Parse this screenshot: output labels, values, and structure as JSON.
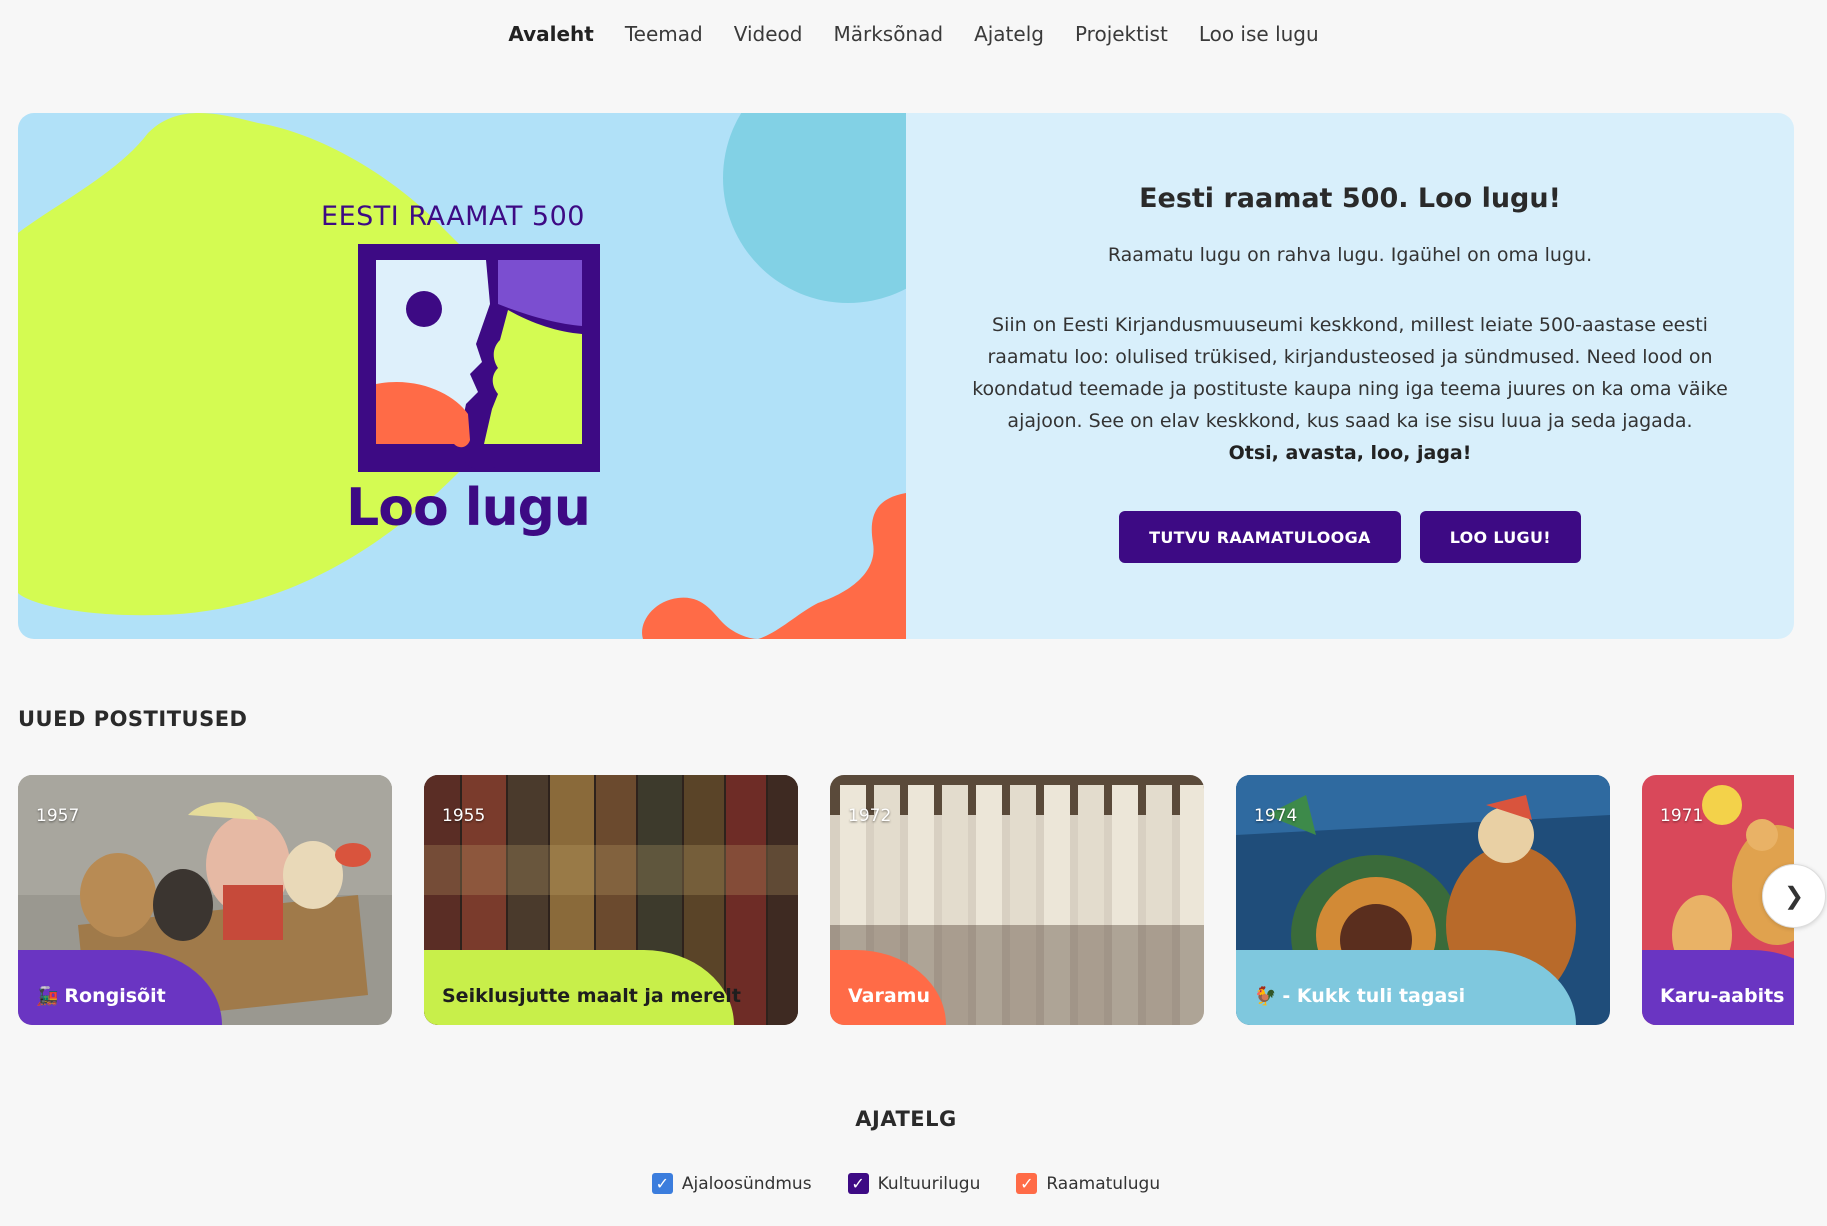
{
  "nav": {
    "items": [
      {
        "label": "Avaleht",
        "active": true
      },
      {
        "label": "Teemad"
      },
      {
        "label": "Videod"
      },
      {
        "label": "Märksõnad"
      },
      {
        "label": "Ajatelg"
      },
      {
        "label": "Projektist"
      },
      {
        "label": "Loo ise lugu"
      }
    ]
  },
  "hero": {
    "logo_top": "EESTI RAAMAT 500",
    "logo_bottom": "Loo lugu",
    "title": "Eesti raamat 500. Loo lugu!",
    "tagline": "Raamatu lugu on rahva lugu. Igaühel on oma lugu.",
    "body": "Siin on Eesti Kirjandusmuuseumi keskkond, millest leiate 500-aastase eesti raamatu loo: olulised trükised, kirjandusteosed ja sündmused. Need lood on koondatud teemade ja postituste kaupa ning iga teema juures on ka oma väike ajajoon. See on elav keskkond, kus saad ka ise sisu luua ja seda jagada.",
    "strong": "Otsi, avasta, loo, jaga!",
    "btn_primary": "TUTVU RAAMATULOOGA",
    "btn_secondary": "LOO LUGU!",
    "colors": {
      "lime": "#d4fb52",
      "sky": "#b1e1f8",
      "coral": "#ff6b47",
      "purple": "#3d0a84",
      "teal": "#82d1e5"
    }
  },
  "posts": {
    "title": "UUED POSTITUSED",
    "items": [
      {
        "year": "1957",
        "emoji": "🚂",
        "label": "Rongisõit",
        "color": "#6a35c2",
        "text_color": "#ffffff"
      },
      {
        "year": "1955",
        "emoji": "",
        "label": "Seiklusjutte maalt ja merelt",
        "color": "#c8ef4a",
        "text_color": "#1e1e1e"
      },
      {
        "year": "1972",
        "emoji": "",
        "label": "Varamu",
        "color": "#ff6b47",
        "text_color": "#ffffff"
      },
      {
        "year": "1974",
        "emoji": "🐓",
        "label": "- Kukk tuli tagasi",
        "color": "#7fc8de",
        "text_color": "#ffffff"
      },
      {
        "year": "1971",
        "emoji": "",
        "label": "Karu-aabits",
        "color": "#6a35c2",
        "text_color": "#ffffff"
      }
    ],
    "next": "❯"
  },
  "timeline": {
    "title": "AJATELG",
    "legend": [
      {
        "label": "Ajaloosündmus",
        "color": "#3b7ddd"
      },
      {
        "label": "Kultuurilugu",
        "color": "#3d0a84"
      },
      {
        "label": "Raamatulugu",
        "color": "#ff6b47"
      }
    ]
  }
}
